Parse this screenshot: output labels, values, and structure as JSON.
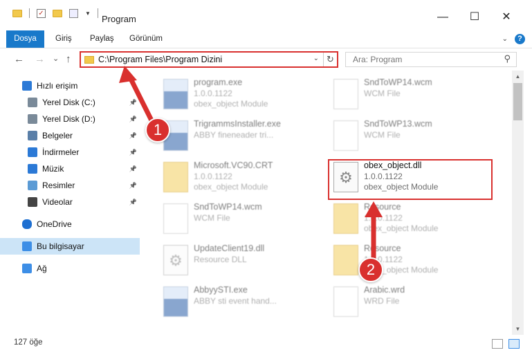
{
  "window": {
    "title": "Program",
    "minimize": "—",
    "maximize": "☐",
    "close": "✕"
  },
  "ribbon": {
    "tabs": [
      {
        "label": "Dosya",
        "active": true
      },
      {
        "label": "Giriş"
      },
      {
        "label": "Paylaş"
      },
      {
        "label": "Görünüm"
      }
    ],
    "help": "?"
  },
  "nav": {
    "back": "←",
    "forward": "→",
    "recent": "⌄",
    "up": "↑",
    "path": "C:\\Program Files\\Program Dizini",
    "refresh": "↻",
    "dropdown": "⌄",
    "search_placeholder": "Ara: Program",
    "search_icon": "⚲"
  },
  "sidebar": {
    "items": [
      {
        "label": "Hızlı erişim",
        "icon": "star-icon",
        "pinned": false
      },
      {
        "label": "Yerel Disk (C:)",
        "icon": "drive-icon",
        "pinned": true
      },
      {
        "label": "Yerel Disk (D:)",
        "icon": "drive-icon",
        "pinned": true
      },
      {
        "label": "Belgeler",
        "icon": "documents-icon",
        "pinned": true
      },
      {
        "label": "İndirmeler",
        "icon": "download-icon",
        "pinned": true
      },
      {
        "label": "Müzik",
        "icon": "music-icon",
        "pinned": true
      },
      {
        "label": "Resimler",
        "icon": "pictures-icon",
        "pinned": true
      },
      {
        "label": "Videolar",
        "icon": "video-icon",
        "pinned": true
      },
      {
        "label": "OneDrive",
        "icon": "cloud-icon",
        "pinned": false
      },
      {
        "label": "Bu bilgisayar",
        "icon": "computer-icon",
        "pinned": false,
        "selected": true
      },
      {
        "label": "Ağ",
        "icon": "network-icon",
        "pinned": false
      }
    ]
  },
  "files": [
    {
      "name": "program.exe",
      "version": "1.0.0.1122",
      "desc": "obex_object Module",
      "kind": "exe"
    },
    {
      "name": "SndToWP14.wcm",
      "version": "WCM File",
      "desc": "",
      "kind": "doc"
    },
    {
      "name": "TrigrammsInstaller.exe",
      "version": "ABBY fineneader tri...",
      "desc": "",
      "kind": "exe"
    },
    {
      "name": "SndToWP13.wcm",
      "version": "WCM File",
      "desc": "",
      "kind": "doc"
    },
    {
      "name": "Microsoft.VC90.CRT",
      "version": "1.0.0.1122",
      "desc": "obex_object Module",
      "kind": "folder"
    },
    {
      "name": "obex_object.dll",
      "version": "1.0.0.1122",
      "desc": "obex_object Module",
      "kind": "dll",
      "focus": true
    },
    {
      "name": "SndToWP14.wcm",
      "version": "WCM File",
      "desc": "",
      "kind": "doc"
    },
    {
      "name": "Resource",
      "version": "1.0.0.1122",
      "desc": "obex_object Module",
      "kind": "folder"
    },
    {
      "name": "UpdateClient19.dll",
      "version": "Resource DLL",
      "desc": "",
      "kind": "dll"
    },
    {
      "name": "Resource",
      "version": "1.0.0.1122",
      "desc": "obex_object Module",
      "kind": "folder"
    },
    {
      "name": "AbbyySTI.exe",
      "version": "ABBY sti event hand...",
      "desc": "",
      "kind": "exe"
    },
    {
      "name": "Arabic.wrd",
      "version": "WRD File",
      "desc": "",
      "kind": "doc"
    }
  ],
  "annotations": {
    "one": "1",
    "two": "2",
    "color": "#d9302e"
  },
  "status": {
    "count": "127 öğe"
  }
}
